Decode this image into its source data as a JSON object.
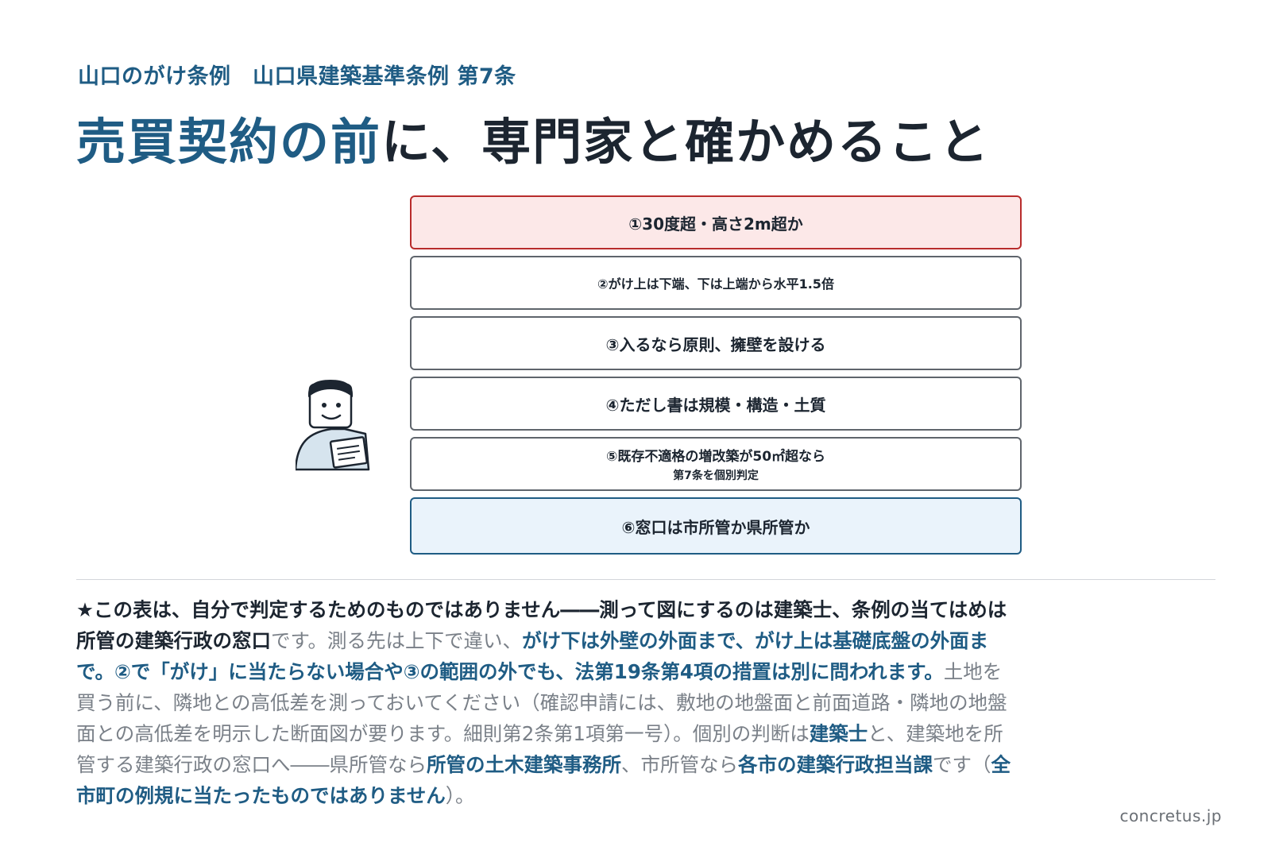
{
  "kicker": "山口のがけ条例　山口県建築基準条例 第7条",
  "headline": {
    "highlight": "売買契約の前",
    "rest": "に、専門家と確かめること"
  },
  "steps": [
    {
      "label": "①30度超・高さ2m超か"
    },
    {
      "label": "②がけ上は下端、下は上端から水平1.5倍"
    },
    {
      "label": "③入るなら原則、擁壁を設ける"
    },
    {
      "label": "④ただし書は規模・構造・土質"
    },
    {
      "label": "⑤既存不適格の増改築が50㎡超なら",
      "sub": "第7条を個別判定"
    },
    {
      "label": "⑥窓口は市所管か県所管か"
    }
  ],
  "note": {
    "p1": "★この表は、自分で判定するためのものではありません――測って図にするのは建築士、条例の当てはめは所管の建築行政の窓口",
    "p2": "です。測る先は上下で違い、",
    "p3": "がけ下は外壁の外面まで、がけ上は基礎底盤の外面まで。②で「がけ」に当たらない場合や③の範囲の外でも、法第19条第4項の措置は別に問われます。",
    "p4": "土地を買う前に、隣地との高低差を測っておいてください（確認申請には、敷地の地盤面と前面道路・隣地の地盤面との高低差を明示した断面図が要ります。細則第2条第1項第一号）。個別の判断は",
    "p5": "建築士",
    "p6": "と、建築地を所管する建築行政の窓口へ――県所管なら",
    "p7": "所管の土木建築事務所",
    "p8": "、市所管なら",
    "p9": "各市の建築行政担当課",
    "p10": "です（",
    "p11": "全市町の例規に当たったものではありません",
    "p12": "）。"
  },
  "footer": "concretus.jp",
  "colors": {
    "accent": "#1f5c84",
    "warn": "#b82c2c",
    "warn_bg": "#fce8e8",
    "info_bg": "#eaf3fb"
  },
  "icons": {
    "figure": "person-with-document-icon"
  }
}
